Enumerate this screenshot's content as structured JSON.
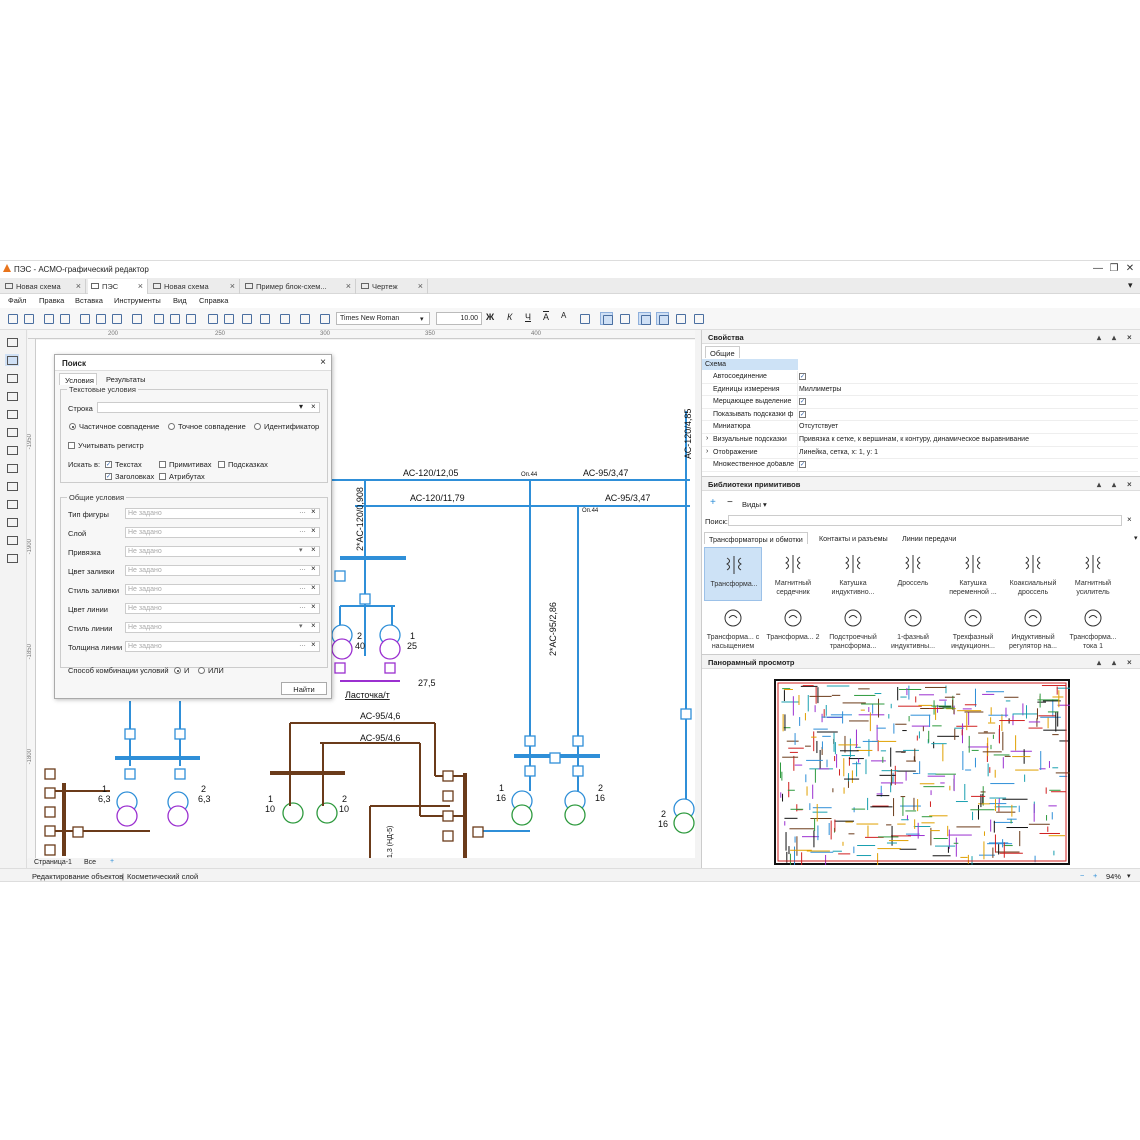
{
  "window": {
    "title": "ПЭС - АСМО-графический редактор",
    "controls": [
      "—",
      "❐",
      "✕"
    ],
    "tabs_dropdown": "▾"
  },
  "doc_tabs": [
    {
      "label": "Новая схема",
      "active": false
    },
    {
      "label": "ПЭС",
      "active": true
    },
    {
      "label": "Новая схема",
      "active": false
    },
    {
      "label": "Пример блок-схем...",
      "active": false
    },
    {
      "label": "Чертеж",
      "active": false
    }
  ],
  "menu": [
    "Файл",
    "Правка",
    "Вставка",
    "Инструменты",
    "Вид",
    "Справка"
  ],
  "toolbar": {
    "font_name": "Times New Roman",
    "font_size": "10.00",
    "bold": "Ж",
    "italic": "К",
    "underline": "Ч",
    "overline": "A",
    "text_color": "A"
  },
  "ruler": {
    "h": [
      "200",
      "250",
      "300",
      "350",
      "400"
    ],
    "v": [
      "-1950",
      "-1900",
      "-1850",
      "-1800"
    ]
  },
  "search_dialog": {
    "title": "Поиск",
    "close": "×",
    "tabs": [
      "Условия",
      "Результаты"
    ],
    "text_group": "Текстовые условия",
    "string_label": "Строка",
    "match_options": [
      "Частичное совпадение",
      "Точное совпадение",
      "Идентификатор"
    ],
    "case_label": "Учитывать регистр",
    "search_in_label": "Искать в:",
    "search_in": [
      {
        "label": "Текстах",
        "checked": true
      },
      {
        "label": "Примитивах",
        "checked": false
      },
      {
        "label": "Подсказках",
        "checked": false
      },
      {
        "label": "Заголовках",
        "checked": true
      },
      {
        "label": "Атрибутах",
        "checked": false
      }
    ],
    "general_group": "Общие условия",
    "fields": [
      {
        "label": "Тип фигуры",
        "value": "Не задано",
        "kind": "dots"
      },
      {
        "label": "Слой",
        "value": "Не задано",
        "kind": "dots"
      },
      {
        "label": "Привязка",
        "value": "Не задано",
        "kind": "drop"
      },
      {
        "label": "Цвет заливки",
        "value": "Не задано",
        "kind": "dots"
      },
      {
        "label": "Стиль заливки",
        "value": "Не задано",
        "kind": "dots"
      },
      {
        "label": "Цвет линии",
        "value": "Не задано",
        "kind": "dots"
      },
      {
        "label": "Стиль линии",
        "value": "Не задано",
        "kind": "drop"
      },
      {
        "label": "Толщина линии",
        "value": "Не задано",
        "kind": "dots"
      }
    ],
    "combine_label": "Способ комбинации условий",
    "combine_and": "И",
    "combine_or": "ИЛИ",
    "find_button": "Найти"
  },
  "diagram": {
    "labels": {
      "l1": "АС-120/12,05",
      "l2": "АС-120/11,79",
      "l3": "АС-95/3,47",
      "l4": "АС-95/3,47",
      "op1": "Оп.44",
      "op2": "Оп.44",
      "v1": "2*АС-120/0,908",
      "v2": "2*АС-95/2,86",
      "v3": "АС-120/4,85",
      "b1": "АС-95/4,6",
      "b2": "АС-95/4,6",
      "st": "Ласточка/т",
      "val": "27,5",
      "t1a": "1",
      "t1b": "6,3",
      "t2a": "2",
      "t2b": "6,3",
      "t3a": "1",
      "t3b": "10",
      "t4a": "2",
      "t4b": "10",
      "t5a": "1",
      "t5b": "16",
      "t6a": "2",
      "t6b": "16",
      "t7a": "2",
      "t7b": "16",
      "t8a": "2",
      "t8b": "40",
      "t9a": "1",
      "t9b": "25",
      "rot": "1,3 (НД-5)"
    }
  },
  "page_bar": {
    "page": "Страница-1",
    "filter": "Все",
    "add": "+"
  },
  "status": {
    "left": "Редактирование объектов",
    "layer": "Косметический слой",
    "zoom": "94%",
    "minus": "−",
    "plus": "+"
  },
  "properties": {
    "title": "Свойства",
    "tab": "Общие",
    "section": "Схема",
    "rows": [
      {
        "k": "Автосоединение",
        "v": "",
        "check": true
      },
      {
        "k": "Единицы измерения",
        "v": "Миллиметры",
        "check": false
      },
      {
        "k": "Мерцающее выделение",
        "v": "",
        "check": true
      },
      {
        "k": "Показывать подсказки ф",
        "v": "",
        "check": true
      },
      {
        "k": "Миниатюра",
        "v": "Отсутствует",
        "check": false
      },
      {
        "k": "Визуальные подсказки",
        "v": "Привязка к сетке, к вершинам, к контуру, динамическое выравнивание",
        "check": false,
        "expand": true
      },
      {
        "k": "Отображение",
        "v": "Линейка, сетка, x: 1, y: 1",
        "check": false,
        "expand": true
      },
      {
        "k": "Множественное добавле",
        "v": "",
        "check": true
      }
    ]
  },
  "library": {
    "title": "Библиотеки примитивов",
    "views": "Виды",
    "search_label": "Поиск:",
    "tabs": [
      "Трансформаторы и обмотки",
      "Контакты и разъемы",
      "Линии передачи"
    ],
    "items": [
      "Трансформа...",
      "Магнитный сердечник",
      "Катушка индуктивно...",
      "Дроссель",
      "Катушка переменной ...",
      "Коаксиальный дроссель",
      "Магнитный усилитель",
      "Трансформа... с насыщением",
      "Трансформа... 2",
      "Подстроечный трансформа...",
      "1-фазный индуктивны...",
      "Трехфазный индукционн...",
      "Индуктивный регулятор на...",
      "Трансформа... тока 1"
    ]
  },
  "panorama": {
    "title": "Панорамный просмотр"
  },
  "colors": {
    "accent": "#2f8fd8",
    "brown": "#6b3b1a",
    "purple": "#9b30d0",
    "green": "#2e9a3e"
  }
}
